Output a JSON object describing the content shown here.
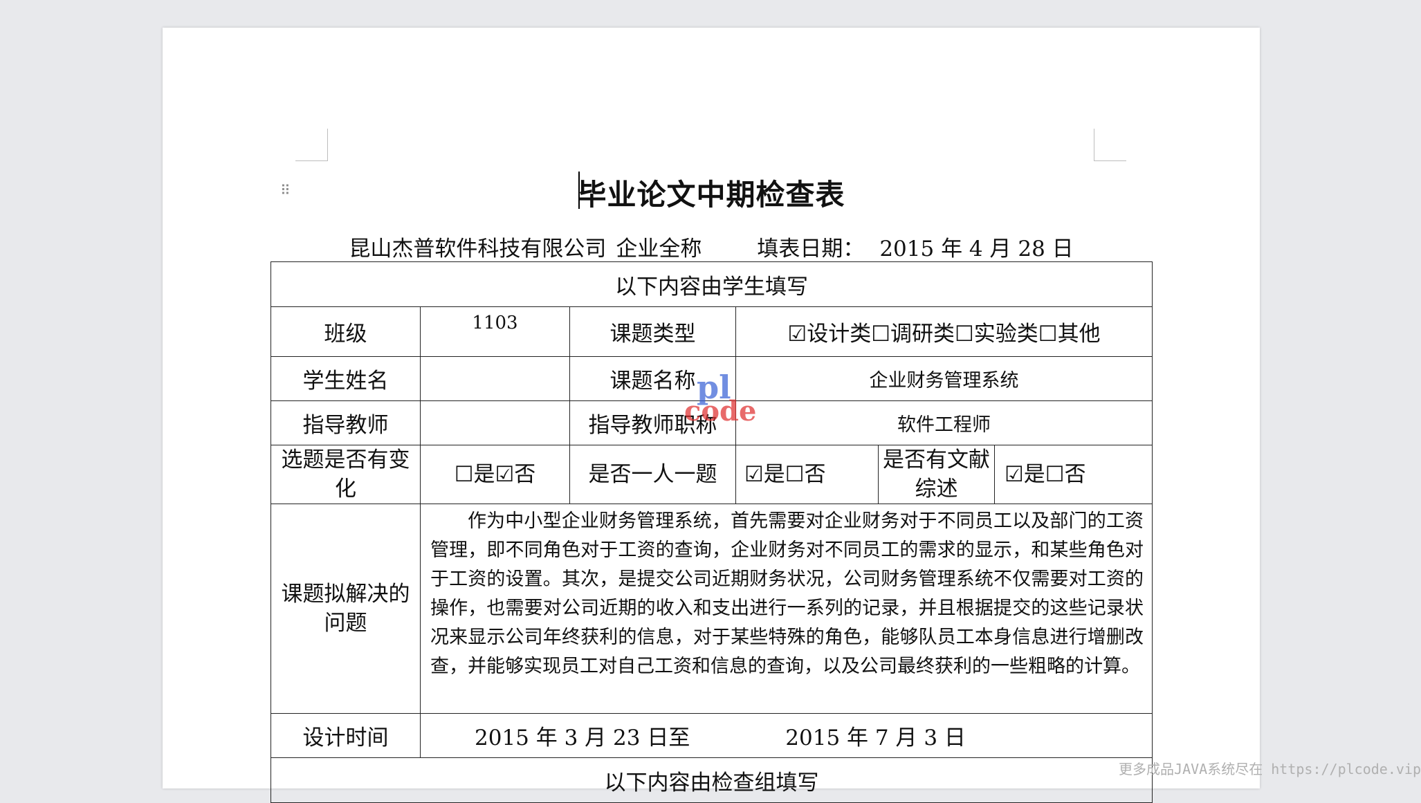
{
  "document": {
    "title": "毕业论文中期检查表",
    "company": "昆山杰普软件科技有限公司",
    "company_label": "企业全称",
    "date_label": "填表日期：",
    "date_value": "2015 年 4 月 28 日"
  },
  "table": {
    "student_section_title": "以下内容由学生填写",
    "class_label": "班级",
    "class_value": "1103",
    "topic_type_label": "课题类型",
    "topic_type_value": "☑设计类☐调研类☐实验类☐其他",
    "student_name_label": "学生姓名",
    "student_name_value": "",
    "topic_name_label": "课题名称",
    "topic_name_value": "企业财务管理系统",
    "advisor_label": "指导教师",
    "advisor_value": "",
    "advisor_title_label": "指导教师职称",
    "advisor_title_value": "软件工程师",
    "topic_changed_label": "选题是否有变化",
    "topic_changed_value": "☐是☑否",
    "one_per_topic_label": "是否一人一题",
    "one_per_topic_value": "☑是☐否",
    "has_review_label": "是否有文献综述",
    "has_review_value": "☑是☐否",
    "problem_label": "课题拟解决的问题",
    "problem_text": "作为中小型企业财务管理系统，首先需要对企业财务对于不同员工以及部门的工资管理，即不同角色对于工资的查询，企业财务对不同员工的需求的显示，和某些角色对于工资的设置。其次，是提交公司近期财务状况，公司财务管理系统不仅需要对工资的操作，也需要对公司近期的收入和支出进行一系列的记录，并且根据提交的这些记录状况来显示公司年终获利的信息，对于某些特殊的角色，能够队员工本身信息进行增删改查，并能够实现员工对自己工资和信息的查询，以及公司最终获利的一些粗略的计算。",
    "design_time_label": "设计时间",
    "design_time_value": "2015 年 3 月 23 日至              2015 年 7 月 3 日",
    "checkgroup_section_title": "以下内容由检查组填写"
  },
  "watermark": {
    "line1": "pl",
    "line2": "code"
  },
  "footer": {
    "text": "更多成品JAVA系统尽在 https://plcode.vip"
  }
}
